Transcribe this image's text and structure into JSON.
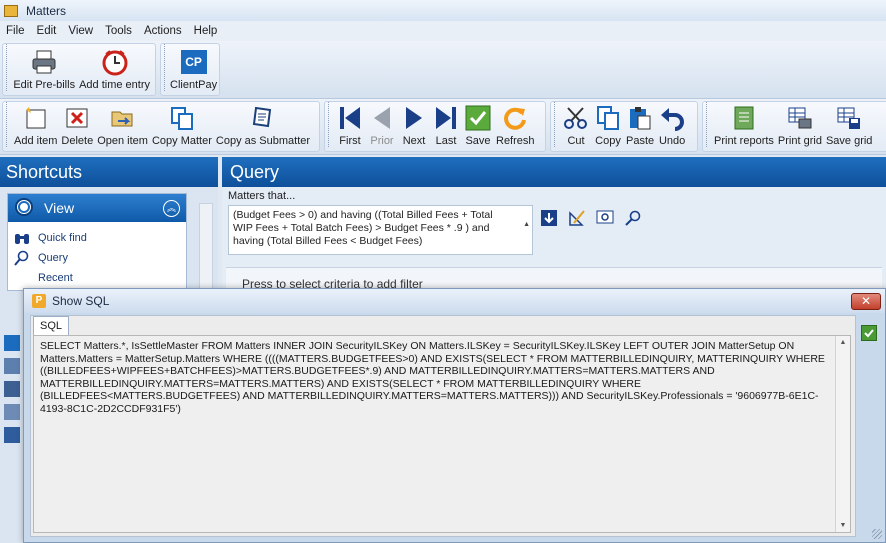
{
  "window": {
    "title": "Matters"
  },
  "menu": [
    "File",
    "Edit",
    "View",
    "Tools",
    "Actions",
    "Help"
  ],
  "ribbon1": {
    "group1": [
      "Edit Pre-bills",
      "Add time entry"
    ],
    "group2": [
      "ClientPay"
    ],
    "clientpay_badge": "CP"
  },
  "ribbon2": {
    "items_group": [
      "Add item",
      "Delete",
      "Open item",
      "Copy Matter",
      "Copy as Submatter"
    ],
    "nav_group": [
      "First",
      "Prior",
      "Next",
      "Last",
      "Save",
      "Refresh"
    ],
    "edit_group": [
      "Cut",
      "Copy",
      "Paste",
      "Undo"
    ],
    "print_group": [
      "Print reports",
      "Print grid",
      "Save grid"
    ]
  },
  "shortcuts": {
    "title": "Shortcuts",
    "view": {
      "label": "View",
      "items": [
        "Quick find",
        "Query",
        "Recent"
      ]
    }
  },
  "query": {
    "title": "Query",
    "matters_that": "Matters that...",
    "expression": "(Budget Fees > 0) and having ((Total Billed Fees + Total WIP Fees + Total Batch Fees) > Budget Fees * .9 ) and having (Total Billed Fees < Budget Fees)",
    "hint": "Press to select criteria to add filter"
  },
  "dialog": {
    "title": "Show SQL",
    "close_label": "✕",
    "tab": "SQL",
    "sql": "SELECT Matters.*, IsSettleMaster FROM Matters INNER JOIN SecurityILSKey ON Matters.ILSKey = SecurityILSKey.ILSKey LEFT OUTER JOIN MatterSetup ON Matters.Matters = MatterSetup.Matters  WHERE ((((MATTERS.BUDGETFEES>0) AND EXISTS(SELECT *   FROM MATTERBILLEDINQUIRY, MATTERINQUIRY  WHERE ((BILLEDFEES+WIPFEES+BATCHFEES)>MATTERS.BUDGETFEES*.9) AND MATTERBILLEDINQUIRY.MATTERS=MATTERS.MATTERS AND MATTERBILLEDINQUIRY.MATTERS=MATTERS.MATTERS) AND EXISTS(SELECT *   FROM MATTERBILLEDINQUIRY  WHERE (BILLEDFEES<MATTERS.BUDGETFEES) AND MATTERBILLEDINQUIRY.MATTERS=MATTERS.MATTERS))) AND SecurityILSKey.Professionals = '9606977B-6E1C-4193-8C1C-2D2CCDF931F5')"
  },
  "colors": {
    "accent": "#1260b0",
    "panel_head": "#0e4f9a",
    "ok_green": "#4a9a36",
    "close_red": "#c2402c"
  }
}
